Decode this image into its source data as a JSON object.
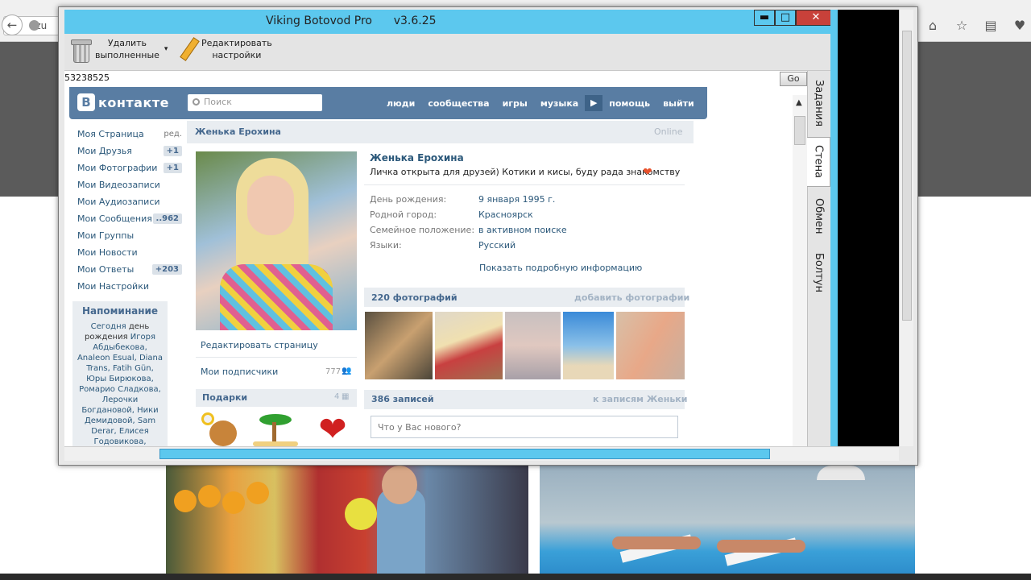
{
  "window": {
    "title": "Viking Botovod Pro      v3.6.25",
    "controls": {
      "minimize": "▬",
      "maximize": "□",
      "close": "✕"
    }
  },
  "background_browser": {
    "url_text": "izu"
  },
  "toolbar": {
    "delete_done": "Удалить\nвыполненные",
    "delete_arrow": "▾",
    "edit_settings": "Редактировать\nнастройки"
  },
  "address": {
    "value": "53238525",
    "go": "Go"
  },
  "side_tabs": [
    "Задания",
    "Стена",
    "Обмен",
    "Болтун"
  ],
  "vk": {
    "logo_letter": "В",
    "logo_text": "контакте",
    "search_placeholder": "Поиск",
    "nav": [
      "люди",
      "сообщества",
      "игры",
      "музыка",
      "помощь",
      "выйти"
    ],
    "play": "▶",
    "menu": [
      {
        "label": "Моя Страница",
        "extra": "ред."
      },
      {
        "label": "Мои Друзья",
        "badge": "+1"
      },
      {
        "label": "Мои Фотографии",
        "badge": "+1"
      },
      {
        "label": "Мои Видеозаписи"
      },
      {
        "label": "Мои Аудиозаписи"
      },
      {
        "label": "Мои Сообщения",
        "badge": "..962"
      },
      {
        "label": "Мои Группы"
      },
      {
        "label": "Мои Новости"
      },
      {
        "label": "Мои Ответы",
        "badge": "+203"
      },
      {
        "label": "Мои Настройки"
      }
    ],
    "reminder": {
      "title": "Напоминание",
      "today": "Сегодня",
      "birthday": "день рождения",
      "names": "Игоря Абдыбекова, Analeon Esual, Diana Trans, Fatih Gün, Юры Бирюкова, Ромарио Сладкова, Лерочки Богдановой, Ники Демидовой, Sam Derar, Елисея Годовикова, Елизаветы"
    },
    "profile": {
      "bar_name": "Женька Ерохина",
      "online": "Online",
      "name": "Женька Ерохина",
      "status": "Личка открыта для друзей) Котики и кисы, буду рада знакомству",
      "heart": "❤",
      "info": [
        {
          "key": "День рождения:",
          "value": "9 января 1995 г."
        },
        {
          "key": "Родной город:",
          "value": "Красноярск"
        },
        {
          "key": "Семейное положение:",
          "value": "в активном поиске"
        },
        {
          "key": "Языки:",
          "value": "Русский"
        }
      ],
      "show_more": "Показать подробную информацию",
      "edit_page": "Редактировать страницу",
      "subscribers": "Мои подписчики",
      "subscribers_count": "777",
      "gifts": "Подарки",
      "gifts_count": "4",
      "photos_count": "220 фотографий",
      "add_photos": "добавить фотографии",
      "posts_count": "386 записей",
      "to_posts": "к записям Женьки",
      "post_placeholder": "Что у Вас нового?"
    }
  }
}
